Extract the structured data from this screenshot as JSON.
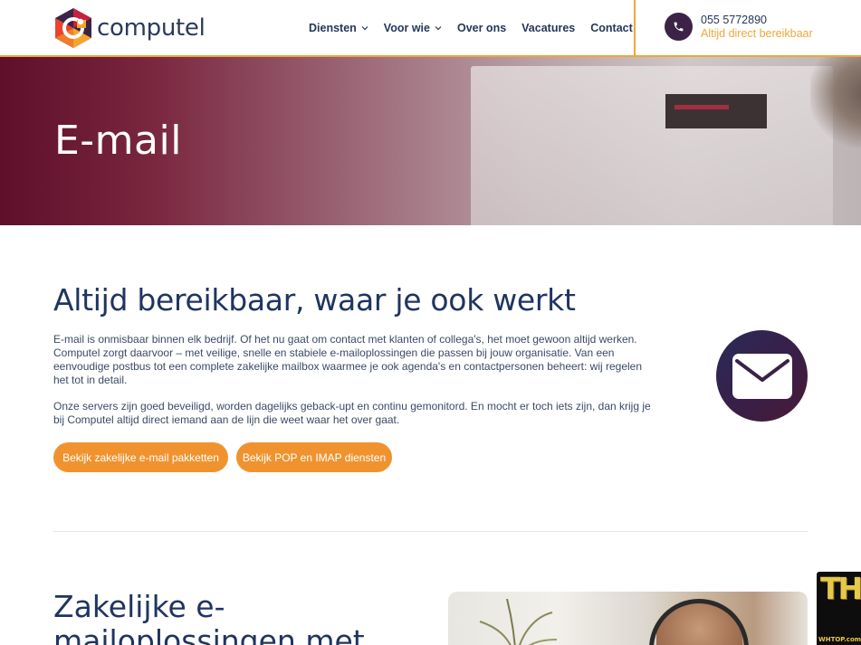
{
  "header": {
    "logo_text": "computel",
    "nav": [
      {
        "label": "Diensten",
        "has_dropdown": true
      },
      {
        "label": "Voor wie",
        "has_dropdown": true
      },
      {
        "label": "Over ons",
        "has_dropdown": false
      },
      {
        "label": "Vacatures",
        "has_dropdown": false
      },
      {
        "label": "Contact",
        "has_dropdown": false
      }
    ],
    "phone_number": "055 5772890",
    "phone_sub": "Altijd direct bereikbaar"
  },
  "hero": {
    "title": "E-mail"
  },
  "section1": {
    "title": "Altijd bereikbaar, waar je ook werkt",
    "paragraph1": "E-mail is onmisbaar binnen elk bedrijf. Of het nu gaat om contact met klanten of collega's, het moet gewoon altijd werken. Computel zorgt daarvoor – met veilige, snelle en stabiele e-mailoplossingen die passen bij jouw organisatie. Van een eenvoudige postbus tot een complete zakelijke mailbox waarmee je ook agenda's en contactpersonen beheert: wij regelen het tot in detail.",
    "paragraph2": "Onze servers zijn goed beveiligd, worden dagelijks geback-upt en continu gemonitord. En mocht er toch iets zijn, dan krijg je bij Computel altijd direct iemand aan de lijn die weet waar het over gaat.",
    "button1": "Bekijk zakelijke e-mail pakketten",
    "button2": "Bekijk POP en IMAP diensten"
  },
  "section2": {
    "title": "Zakelijke e-mailoplossingen met"
  },
  "badge": {
    "letters": "TH",
    "site": "WHTOP.com"
  },
  "colors": {
    "accent": "#f0932f",
    "navy": "#1f3561",
    "plum": "#3c2346"
  },
  "icons": {
    "phone": "phone-icon",
    "mail": "envelope-icon",
    "dropdown": "chevron-down-icon"
  }
}
